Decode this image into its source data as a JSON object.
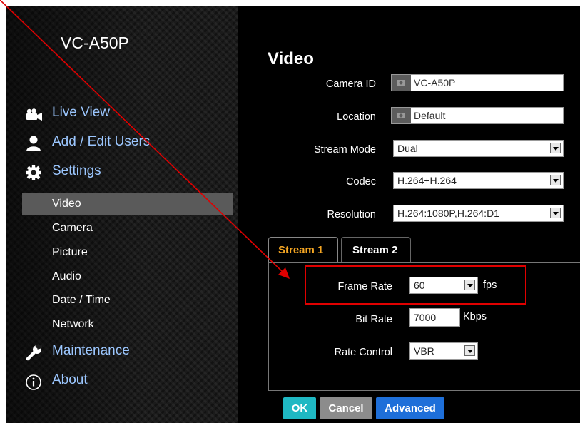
{
  "sidebar": {
    "device_name": "VC-A50P",
    "items": [
      {
        "label": "Live View"
      },
      {
        "label": "Add / Edit Users"
      },
      {
        "label": "Settings"
      }
    ],
    "sub_items": [
      {
        "label": "Video"
      },
      {
        "label": "Camera"
      },
      {
        "label": "Picture"
      },
      {
        "label": "Audio"
      },
      {
        "label": "Date / Time"
      },
      {
        "label": "Network"
      }
    ],
    "bottom_items": [
      {
        "label": "Maintenance"
      },
      {
        "label": "About"
      }
    ],
    "active_sub_item": "Video"
  },
  "main": {
    "title": "Video",
    "fields": {
      "camera_id": {
        "label": "Camera ID",
        "value": "VC-A50P"
      },
      "location": {
        "label": "Location",
        "value": "Default"
      },
      "stream_mode": {
        "label": "Stream Mode",
        "value": "Dual"
      },
      "codec": {
        "label": "Codec",
        "value": "H.264+H.264"
      },
      "resolution": {
        "label": "Resolution",
        "value": "H.264:1080P,H.264:D1"
      }
    },
    "tabs": [
      {
        "label": "Stream 1",
        "active": true
      },
      {
        "label": "Stream 2",
        "active": false
      }
    ],
    "stream": {
      "frame_rate": {
        "label": "Frame Rate",
        "value": "60",
        "unit": "fps"
      },
      "bit_rate": {
        "label": "Bit Rate",
        "value": "7000",
        "unit": "Kbps"
      },
      "rate_control": {
        "label": "Rate Control",
        "value": "VBR"
      }
    },
    "buttons": {
      "ok": "OK",
      "cancel": "Cancel",
      "advanced": "Advanced"
    }
  },
  "colors": {
    "nav_label": "#9cc7ff",
    "active_tab": "#f5a623",
    "ok_button": "#1fb8c3",
    "cancel_button": "#8c8c8c",
    "advanced_button": "#1e6fd9",
    "annotation": "#e00000"
  },
  "icons": {
    "live_view": "video-camera-icon",
    "users": "user-icon",
    "settings": "gear-icon",
    "maintenance": "wrench-icon",
    "about": "info-icon"
  }
}
